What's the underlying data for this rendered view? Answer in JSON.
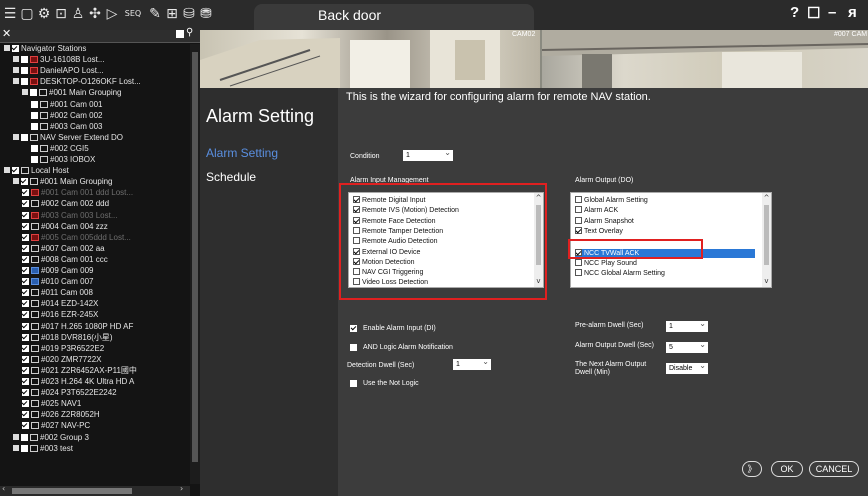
{
  "window": {
    "title": "Back door",
    "help": "?",
    "restore": "☐",
    "minimize": "–",
    "close": "ᴙ"
  },
  "toolbar": {
    "icons": [
      "menu-icon",
      "monitor-icon",
      "settings-icon",
      "playback-icon",
      "person-icon",
      "ptz-icon",
      "play-icon",
      "sequence-icon",
      "edit-icon",
      "layout-icon",
      "map-icon",
      "database-icon"
    ],
    "seq_label": "SEQ"
  },
  "tree": {
    "search_placeholder": "",
    "rows": [
      {
        "indent": 0,
        "label": "Navigator Stations",
        "exp": true,
        "chk": true,
        "icon": "",
        "dim": false
      },
      {
        "indent": 1,
        "label": "3U-16108B Lost...",
        "exp": true,
        "chk": false,
        "icon": "red",
        "dim": false
      },
      {
        "indent": 1,
        "label": "DanielAPO Lost...",
        "exp": true,
        "chk": false,
        "icon": "red",
        "dim": false
      },
      {
        "indent": 1,
        "label": "DESKTOP-O126OKF Lost...",
        "exp": true,
        "chk": false,
        "icon": "red",
        "dim": false
      },
      {
        "indent": 2,
        "label": "#001 Main Grouping",
        "exp": true,
        "chk": false,
        "icon": "cam",
        "dim": false
      },
      {
        "indent": 3,
        "label": "#001 Cam 001",
        "exp": false,
        "chk": false,
        "icon": "cam",
        "dim": false
      },
      {
        "indent": 3,
        "label": "#002 Cam 002",
        "exp": false,
        "chk": false,
        "icon": "cam",
        "dim": false
      },
      {
        "indent": 3,
        "label": "#003 Cam 003",
        "exp": false,
        "chk": false,
        "icon": "cam",
        "dim": false
      },
      {
        "indent": 1,
        "label": "NAV Server Extend DO",
        "exp": true,
        "chk": false,
        "icon": "cam",
        "dim": false
      },
      {
        "indent": 3,
        "label": "#002 CGI5",
        "exp": false,
        "chk": false,
        "icon": "cam",
        "dim": false
      },
      {
        "indent": 3,
        "label": "#003 IOBOX",
        "exp": false,
        "chk": false,
        "icon": "cam",
        "dim": false
      },
      {
        "indent": 0,
        "label": "Local Host",
        "exp": true,
        "chk": true,
        "icon": "cam",
        "dim": false
      },
      {
        "indent": 1,
        "label": "#001 Main Grouping",
        "exp": true,
        "chk": true,
        "icon": "cam",
        "dim": false
      },
      {
        "indent": 2,
        "label": "#001 Cam 001 ddd Lost...",
        "exp": false,
        "chk": true,
        "icon": "red",
        "dim": true
      },
      {
        "indent": 2,
        "label": "#002 Cam 002 ddd",
        "exp": false,
        "chk": true,
        "icon": "cam",
        "dim": false
      },
      {
        "indent": 2,
        "label": "#003 Cam 003 Lost...",
        "exp": false,
        "chk": true,
        "icon": "red",
        "dim": true
      },
      {
        "indent": 2,
        "label": "#004 Cam 004 zzz",
        "exp": false,
        "chk": true,
        "icon": "cam",
        "dim": false
      },
      {
        "indent": 2,
        "label": "#005 Cam 005ddd Lost...",
        "exp": false,
        "chk": true,
        "icon": "red",
        "dim": true
      },
      {
        "indent": 2,
        "label": "#007 Cam 002 aa",
        "exp": false,
        "chk": true,
        "icon": "cam",
        "dim": false
      },
      {
        "indent": 2,
        "label": "#008 Cam 001 ccc",
        "exp": false,
        "chk": true,
        "icon": "cam",
        "dim": false
      },
      {
        "indent": 2,
        "label": "#009 Cam 009",
        "exp": false,
        "chk": true,
        "icon": "blue",
        "dim": false
      },
      {
        "indent": 2,
        "label": "#010 Cam 007",
        "exp": false,
        "chk": true,
        "icon": "blue",
        "dim": false
      },
      {
        "indent": 2,
        "label": "#011 Cam 008",
        "exp": false,
        "chk": true,
        "icon": "cam",
        "dim": false
      },
      {
        "indent": 2,
        "label": "#014 EZD-142X",
        "exp": false,
        "chk": true,
        "icon": "cam",
        "dim": false
      },
      {
        "indent": 2,
        "label": "#016 EZR-245X",
        "exp": false,
        "chk": true,
        "icon": "cam",
        "dim": false
      },
      {
        "indent": 2,
        "label": "#017 H.265 1080P HD AF",
        "exp": false,
        "chk": true,
        "icon": "cam",
        "dim": false
      },
      {
        "indent": 2,
        "label": "#018 DVR816(小星)",
        "exp": false,
        "chk": true,
        "icon": "cam",
        "dim": false
      },
      {
        "indent": 2,
        "label": "#019 P3R6522E2",
        "exp": false,
        "chk": true,
        "icon": "cam",
        "dim": false
      },
      {
        "indent": 2,
        "label": "#020 ZMR7722X",
        "exp": false,
        "chk": true,
        "icon": "cam",
        "dim": false
      },
      {
        "indent": 2,
        "label": "#021 Z2R6452AX-P11國中",
        "exp": false,
        "chk": true,
        "icon": "cam",
        "dim": false
      },
      {
        "indent": 2,
        "label": "#023 H.264 4K Ultra HD A",
        "exp": false,
        "chk": true,
        "icon": "cam",
        "dim": false
      },
      {
        "indent": 2,
        "label": "#024 P3T6522E2242",
        "exp": false,
        "chk": true,
        "icon": "cam",
        "dim": false
      },
      {
        "indent": 2,
        "label": "#025 NAV1",
        "exp": false,
        "chk": true,
        "icon": "cam",
        "dim": false
      },
      {
        "indent": 2,
        "label": "#026 Z2R8052H",
        "exp": false,
        "chk": true,
        "icon": "cam",
        "dim": false
      },
      {
        "indent": 2,
        "label": "#027 NAV-PC",
        "exp": false,
        "chk": true,
        "icon": "cam",
        "dim": false
      },
      {
        "indent": 1,
        "label": "#002 Group 3",
        "exp": true,
        "chk": false,
        "icon": "cam",
        "dim": false
      },
      {
        "indent": 1,
        "label": "#003 test",
        "exp": true,
        "chk": false,
        "icon": "cam",
        "dim": false
      }
    ]
  },
  "cameras": {
    "left_label": "CAM02",
    "right_label": "#007 CAM"
  },
  "dialog": {
    "title": "Alarm Setting",
    "nav": [
      "Alarm Setting",
      "Schedule"
    ],
    "wizard_text": "This is the wizard for configuring alarm for remote NAV station.",
    "condition_label": "Condition",
    "condition_value": "1",
    "input_title": "Alarm Input Management",
    "inputs": [
      {
        "label": "Remote Digital Input",
        "checked": true
      },
      {
        "label": "Remote IVS (Motion) Detection",
        "checked": true
      },
      {
        "label": "Remote Face Detection",
        "checked": true
      },
      {
        "label": "Remote Tamper Detection",
        "checked": false
      },
      {
        "label": "Remote Audio Detection",
        "checked": false
      },
      {
        "label": "External IO Device",
        "checked": true
      },
      {
        "label": "Motion Detection",
        "checked": true
      },
      {
        "label": "NAV CGI Triggering",
        "checked": false
      },
      {
        "label": "Video Loss Detection",
        "checked": false
      }
    ],
    "output_title": "Alarm Output (DO)",
    "outputs": [
      {
        "label": "Global Alarm Setting",
        "checked": false,
        "selected": false
      },
      {
        "label": "Alarm ACK",
        "checked": false,
        "selected": false
      },
      {
        "label": "Alarm Snapshot",
        "checked": false,
        "selected": false
      },
      {
        "label": "Text Overlay",
        "checked": true,
        "selected": false
      },
      {
        "label": "NCC TVWall ACK",
        "checked": true,
        "selected": true
      },
      {
        "label": "NCC Play Sound",
        "checked": false,
        "selected": false
      },
      {
        "label": "NCC Global Alarm Setting",
        "checked": false,
        "selected": false
      }
    ],
    "enable_di_label": "Enable Alarm Input (DI)",
    "enable_di": true,
    "and_logic_label": "AND Logic Alarm Notification",
    "and_logic": false,
    "detection_dwell_label": "Detection Dwell (Sec)",
    "detection_dwell_value": "1",
    "not_logic_label": "Use the Not Logic",
    "not_logic": false,
    "pre_alarm_label": "Pre-alarm Dwell (Sec)",
    "pre_alarm_value": "1",
    "output_dwell_label": "Alarm Output Dwell (Sec)",
    "output_dwell_value": "5",
    "next_output_label": "The Next Alarm Output Dwell (Min)",
    "next_output_value": "Disable",
    "next_button": "》",
    "ok_button": "OK",
    "cancel_button": "CANCEL"
  },
  "colors": {
    "highlight_red": "#e02020",
    "selection_blue": "#2a78d6",
    "nav_active": "#5a8fe0"
  }
}
